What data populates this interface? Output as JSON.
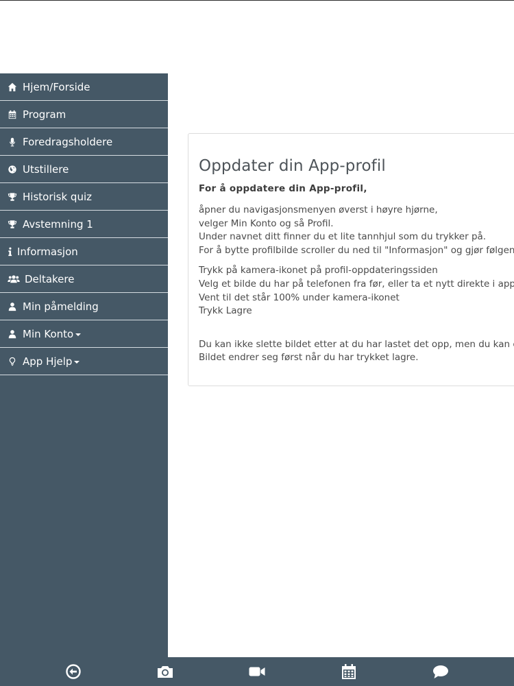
{
  "sidebar": {
    "items": [
      {
        "label": "Hjem/Forside",
        "icon": "home-icon"
      },
      {
        "label": "Program",
        "icon": "calendar-icon"
      },
      {
        "label": "Foredragsholdere",
        "icon": "microphone-icon"
      },
      {
        "label": "Utstillere",
        "icon": "globe-icon"
      },
      {
        "label": "Historisk quiz",
        "icon": "trophy-icon"
      },
      {
        "label": "Avstemning 1",
        "icon": "trophy-icon"
      },
      {
        "label": "Informasjon",
        "icon": "info-icon"
      },
      {
        "label": "Deltakere",
        "icon": "users-icon"
      },
      {
        "label": "Min påmelding",
        "icon": "user-icon"
      },
      {
        "label": "Min Konto",
        "icon": "user-icon"
      },
      {
        "label": "App Hjelp",
        "icon": "lightbulb-icon"
      }
    ]
  },
  "content": {
    "title": "Oppdater din App-profil",
    "subtitle": "For å oppdatere din App-profil,",
    "para1": [
      "åpner du navigasjonsmenyen øverst i høyre hjørne,",
      "velger Min Konto og så Profil.",
      "Under navnet ditt finner du et lite tannhjul som du trykker på.",
      "For å bytte profilbilde scroller du ned til \"Informasjon\" og gjør følgende:"
    ],
    "para2": [
      "Trykk på kamera-ikonet på profil-oppdateringssiden",
      "Velg et bilde du har på telefonen fra før, eller ta et nytt direkte i appen",
      "Vent til det står 100% under kamera-ikonet",
      "Trykk Lagre"
    ],
    "para3": [
      "Du kan ikke slette bildet etter at du har lastet det opp, men du kan endre",
      "Bildet endrer seg først når du har trykket lagre."
    ]
  },
  "bottom_bar": {
    "items": [
      "back-icon",
      "camera-icon",
      "video-icon",
      "calendar-icon",
      "chat-icon"
    ]
  },
  "colors": {
    "sidebar_bg": "#455866",
    "divider": "#d6dde2"
  }
}
